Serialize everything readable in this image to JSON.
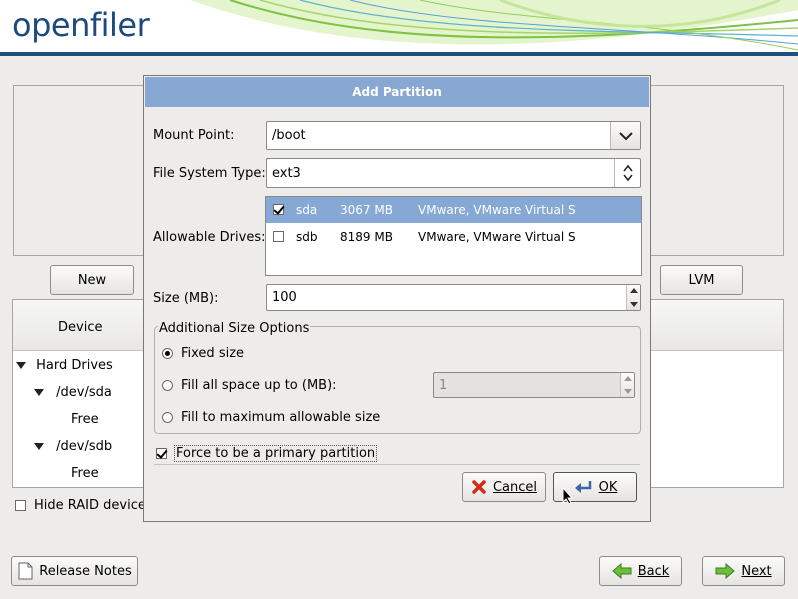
{
  "header": {
    "logo": "openfiler"
  },
  "main": {
    "new_button": "New",
    "lvm_button": "LVM",
    "tree": {
      "header_device": "Device",
      "rows": [
        {
          "label": "Hard Drives"
        },
        {
          "label": "/dev/sda"
        },
        {
          "label": "Free"
        },
        {
          "label": "/dev/sdb"
        },
        {
          "label": "Free"
        }
      ]
    },
    "hide_raid_label": "Hide RAID device/"
  },
  "footer": {
    "release_notes": "Release Notes",
    "back": "Back",
    "next": "Next"
  },
  "dialog": {
    "title": "Add Partition",
    "mount_point_label": "Mount Point:",
    "mount_point_value": "/boot",
    "fs_type_label": "File System Type:",
    "fs_type_value": "ext3",
    "allowable_drives_label": "Allowable Drives:",
    "drives": [
      {
        "name": "sda",
        "size": "3067 MB",
        "model": "VMware, VMware Virtual S",
        "checked": true,
        "selected": true
      },
      {
        "name": "sdb",
        "size": "8189 MB",
        "model": "VMware, VMware Virtual S",
        "checked": false,
        "selected": false
      }
    ],
    "size_label": "Size (MB):",
    "size_value": "100",
    "additional_options_label": "Additional Size Options",
    "fixed_size_label": "Fixed size",
    "fill_up_to_label": "Fill all space up to (MB):",
    "fill_up_to_value": "1",
    "fill_max_label": "Fill to maximum allowable size",
    "force_primary_label": "Force to be a primary partition",
    "cancel_button": "Cancel",
    "ok_button": "OK"
  },
  "colors": {
    "title_bar": "#87a8d3",
    "selection": "#86a8d5",
    "header_bar": "#1f4f7e"
  }
}
